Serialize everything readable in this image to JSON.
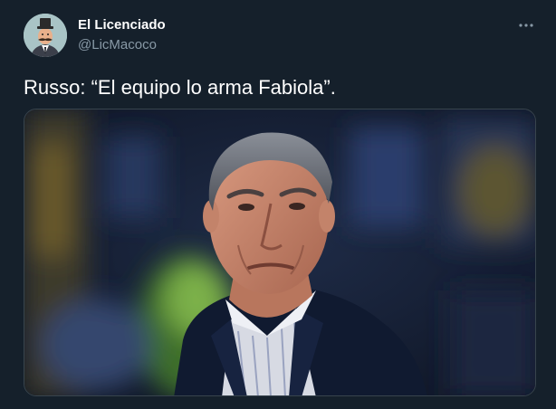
{
  "tweet": {
    "author": {
      "display_name": "El Licenciado",
      "handle": "@LicMacoco",
      "avatar_icon": "avatar-mustache-man-icon"
    },
    "more_icon": "more-horizontal-icon",
    "text": "Russo: “El equipo lo arma Fabiola”.",
    "media": {
      "type": "photo"
    }
  },
  "colors": {
    "background": "#15202b",
    "text_primary": "#ffffff",
    "text_secondary": "#8899a6",
    "border": "#38444d"
  }
}
